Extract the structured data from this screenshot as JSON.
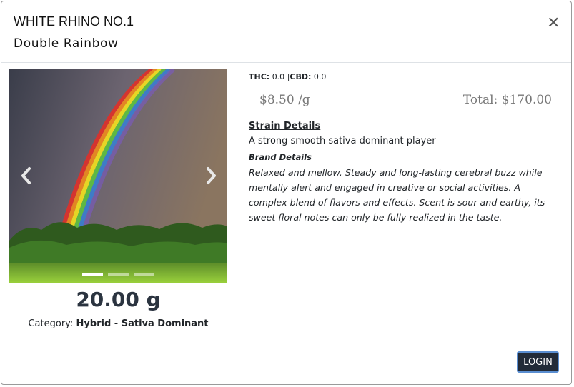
{
  "header": {
    "brand": "WHITE RHINO NO.1",
    "strain": "Double Rainbow",
    "close_icon": "close-icon"
  },
  "carousel": {
    "prev_icon": "chevron-left-icon",
    "next_icon": "chevron-right-icon",
    "slides": 3,
    "active_slide": 1
  },
  "product": {
    "weight": "20.00 g",
    "category_label": "Category:",
    "category_value": "Hybrid - Sativa Dominant"
  },
  "cannabinoids": {
    "thc_label": "THC:",
    "thc_value": "0.0",
    "separator": "|",
    "cbd_label": "CBD:",
    "cbd_value": "0.0"
  },
  "pricing": {
    "price": "$8.50 /g",
    "total": "Total: $170.00"
  },
  "strain_details": {
    "title": "Strain Details",
    "text": "A strong smooth sativa dominant player"
  },
  "brand_details": {
    "title": "Brand Details",
    "text": "Relaxed and mellow. Steady and long-lasting cerebral buzz while mentally alert and engaged in creative or social activities. A complex blend of flavors and effects. Scent is sour and earthy, its sweet floral notes can only be fully realized in the taste."
  },
  "footer": {
    "login_label": "LOGIN"
  },
  "colors": {
    "login_bg": "#222b38",
    "login_border": "#5a8ed1",
    "price_text": "#777777"
  }
}
